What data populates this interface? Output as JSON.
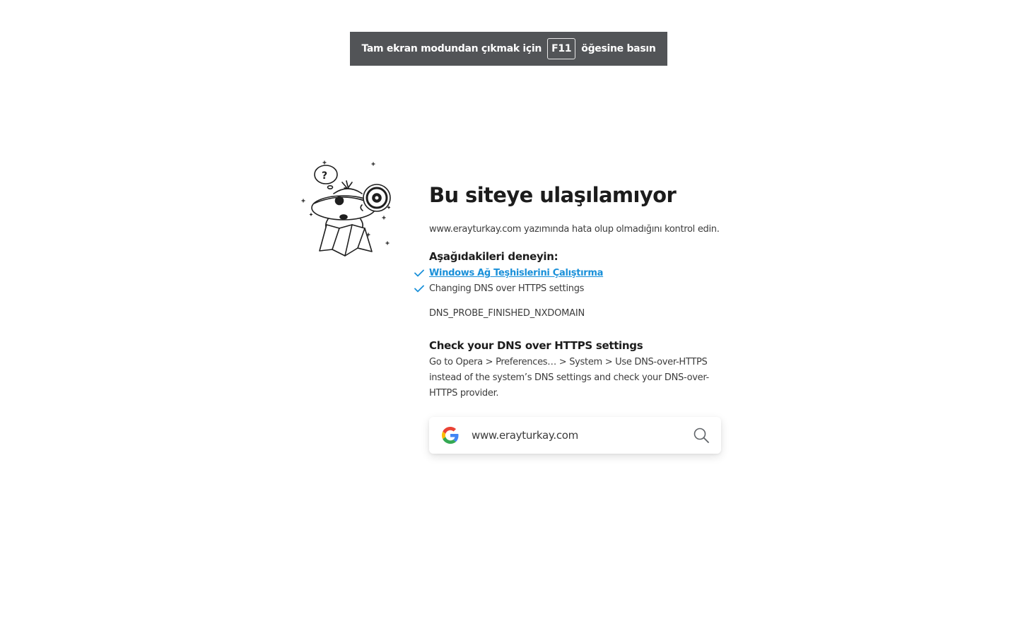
{
  "banner": {
    "text_before": "Tam ekran modundan çıkmak için",
    "key": "F11",
    "text_after": "öğesine basın"
  },
  "error": {
    "title": "Bu siteye ulaşılamıyor",
    "hint": "www.erayturkay.com yazımında hata olup olmadığını kontrol edin.",
    "try_heading": "Aşağıdakileri deneyin:",
    "suggestions": [
      {
        "label": "Windows Ağ Teşhislerini Çalıştırma",
        "link": true
      },
      {
        "label": "Changing DNS over HTTPS settings",
        "link": false
      }
    ],
    "code": "DNS_PROBE_FINISHED_NXDOMAIN",
    "dns_heading": "Check your DNS over HTTPS settings",
    "dns_text": "Go to Opera > Preferences… > System > Use DNS-over-HTTPS instead of the system’s DNS settings and check your DNS-over-HTTPS provider."
  },
  "search": {
    "value": "www.erayturkay.com",
    "engine_icon": "google-icon",
    "button_icon": "search-icon"
  },
  "colors": {
    "banner_bg": "#525457",
    "link": "#1a90d9",
    "check": "#1a90d9"
  }
}
